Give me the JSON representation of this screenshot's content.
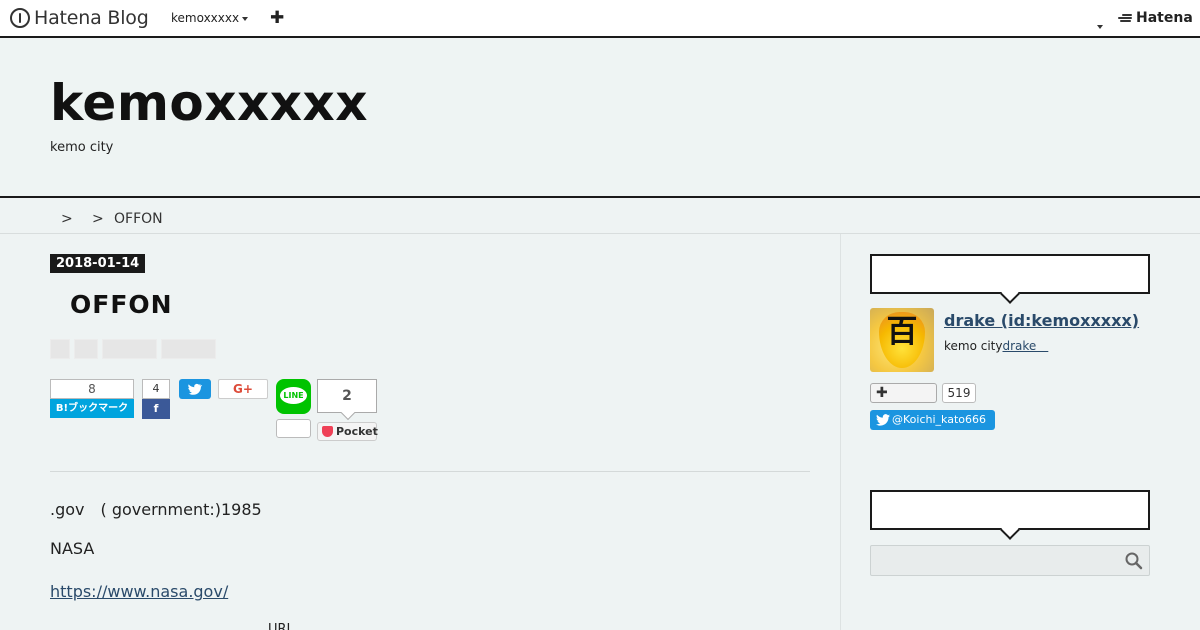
{
  "topbar": {
    "logo_text": "Hatena Blog",
    "blog_select": "kemoxxxxx",
    "add_symbol": "✚",
    "brand": "Hatena"
  },
  "header": {
    "site_title": "kemoxxxxx",
    "site_description": "kemo city"
  },
  "breadcrumb": {
    "separator": ">",
    "current": "OFFON"
  },
  "article": {
    "date": "2018-01-14",
    "title": "OFFON",
    "paragraphs": [
      ".gov　( government:)1985",
      "NASA"
    ],
    "link": "https://www.nasa.gov/",
    "partial_line": "URL"
  },
  "share": {
    "hatena_count": "8",
    "hatena_label": "B!ブックマーク",
    "facebook_count": "4",
    "facebook_label": "f",
    "gplus_label": "G+",
    "line_label": "LINE",
    "pocket_count": "2",
    "pocket_label": "Pocket"
  },
  "sidebar": {
    "profile": {
      "name": "drake (id:kemoxxxxx)",
      "avatar_glyph": "百",
      "desc_text": "kemo city",
      "desc_link": "drake　",
      "follow_symbol": "✚",
      "follower_count": "519",
      "twitter_handle": "@Koichi_kato666"
    },
    "search": {
      "placeholder": ""
    }
  },
  "colors": {
    "hatena_blue": "#00a4de",
    "facebook": "#3b5998",
    "twitter": "#1b95e0",
    "line": "#00c300",
    "pocket": "#ef4056",
    "link": "#2a4a6a"
  },
  "icons": [
    "hatena-logo-icon",
    "caret-down-icon",
    "plus-icon",
    "twitter-bird-icon",
    "pocket-icon",
    "search-icon"
  ]
}
